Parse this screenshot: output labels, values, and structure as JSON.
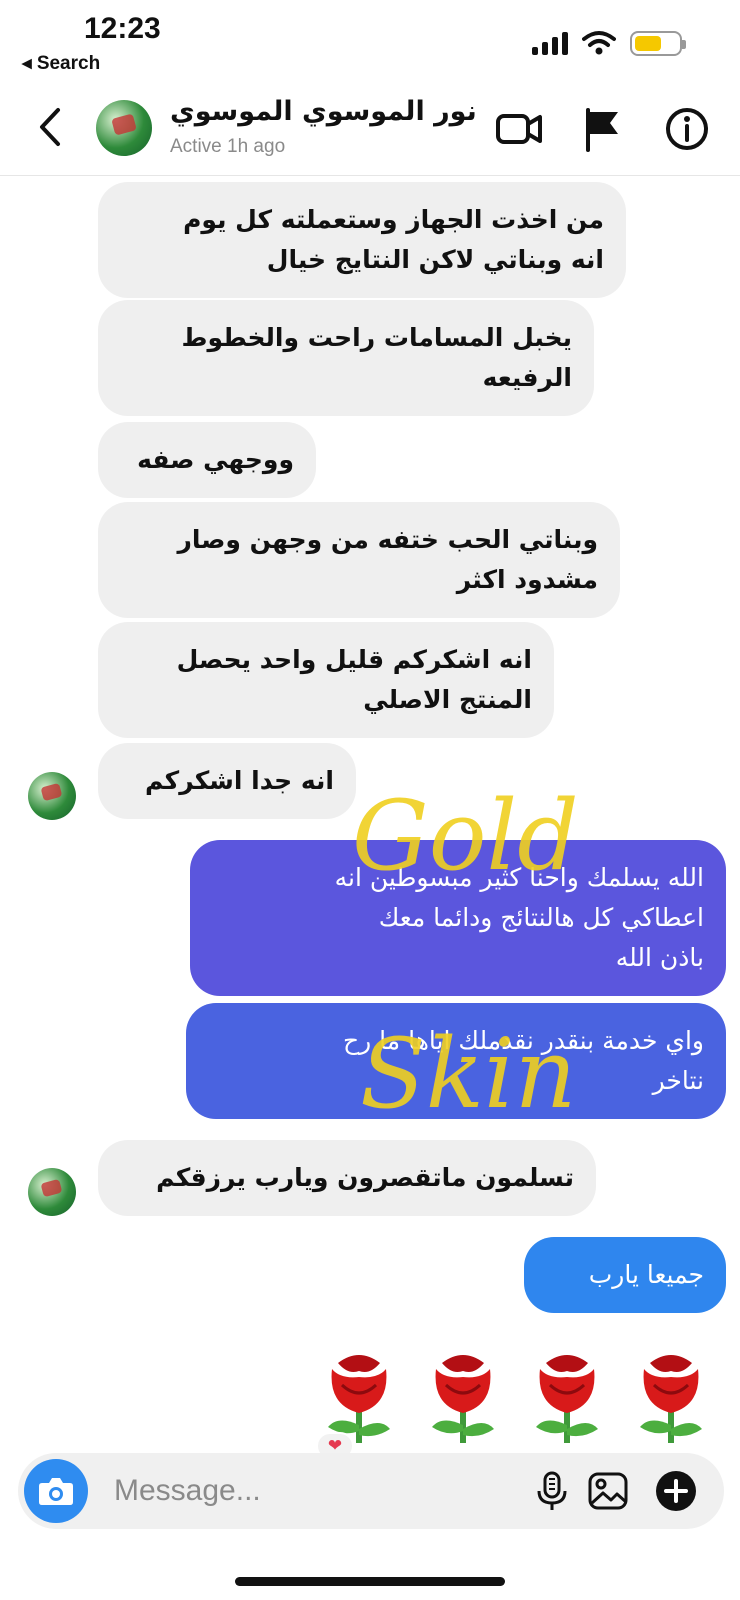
{
  "status_bar": {
    "time": "12:23",
    "back_app": "◂ Search"
  },
  "header": {
    "contact_name": "نور الموسوي الموسوي",
    "active_status": "Active 1h ago",
    "icons": [
      "chevron-left-icon",
      "video-camera-icon",
      "flag-icon",
      "info-icon"
    ]
  },
  "messages": [
    {
      "from": "contact",
      "lines": [
        "من اخذت الجهاز وستعملته كل يوم",
        "انه وبناتي لاكن النتايج خيال"
      ]
    },
    {
      "from": "contact",
      "lines": [
        "يخبل المسامات راحت والخطوط",
        "الرفيعه"
      ]
    },
    {
      "from": "contact",
      "lines": [
        "ووجهي صفه"
      ]
    },
    {
      "from": "contact",
      "lines": [
        "وبناتي الحب ختفه من وجهن وصار",
        "مشدود اكثر"
      ]
    },
    {
      "from": "contact",
      "lines": [
        "انه اشكركم قليل واحد يحصل",
        "المنتج الاصلي"
      ]
    },
    {
      "from": "contact",
      "lines": [
        "انه جدا اشكركم"
      ]
    },
    {
      "from": "me",
      "lines": [
        "الله يسلمك واحنا كثير مبسوطين انه",
        "اعطاكي كل هالنتائج ودائما معك",
        "باذن الله"
      ]
    },
    {
      "from": "me",
      "lines": [
        "واي خدمة بنقدر نقدملك اياها ما رح",
        "نتاخر"
      ]
    },
    {
      "from": "contact",
      "lines": [
        "تسلمون ماتقصرون ويارب يرزقكم"
      ]
    },
    {
      "from": "me",
      "lines": [
        "جميعا يارب"
      ]
    }
  ],
  "watermark": {
    "line1": "Gold",
    "line2": "Skin",
    "color": "#f0d020"
  },
  "reaction": "❤",
  "composer": {
    "placeholder": "Message..."
  },
  "colors": {
    "incoming": "#efefef",
    "outgoing_top": "#5b56dd",
    "outgoing_mid": "#4a63e0",
    "outgoing_bottom": "#2f86ee",
    "accent": "#2f8cf0"
  }
}
